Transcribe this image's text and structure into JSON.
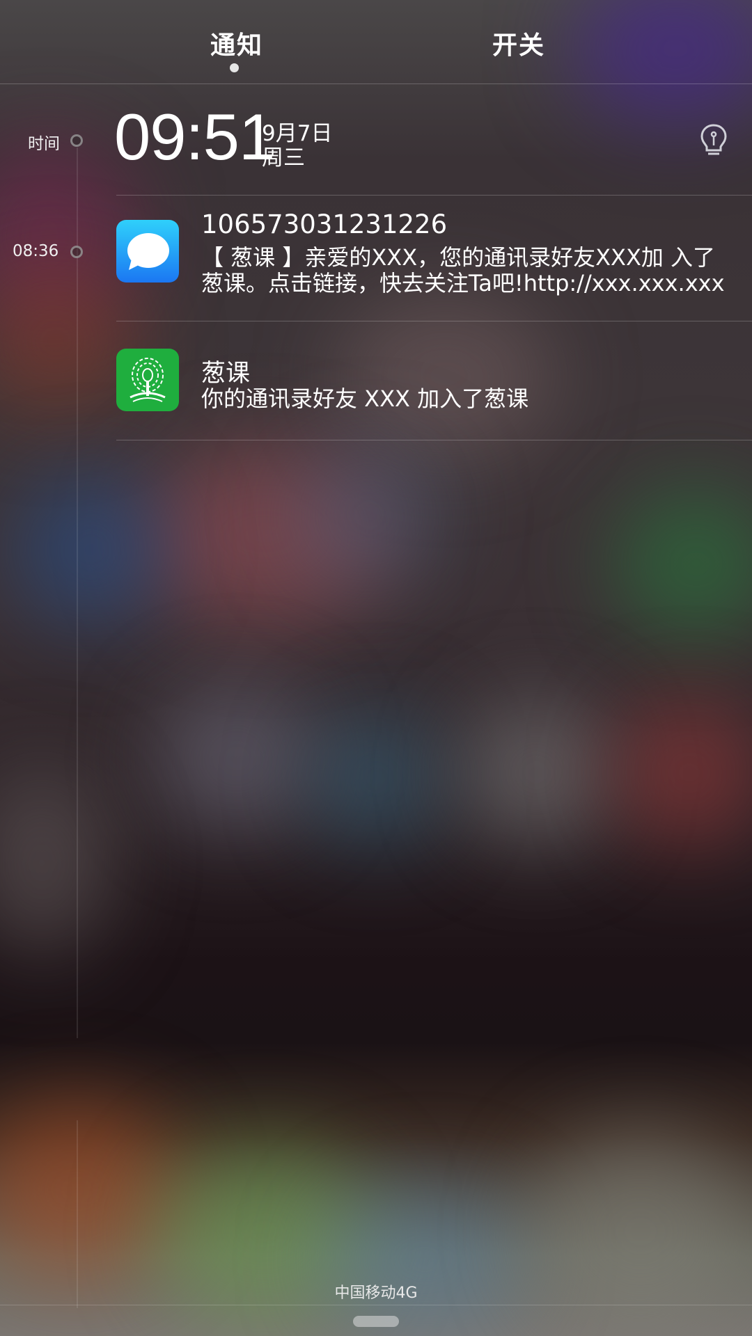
{
  "tabs": [
    {
      "label": "通知",
      "active": true
    },
    {
      "label": "开关",
      "active": false
    }
  ],
  "timeline": {
    "header_label": "时间",
    "entries": [
      "08:36"
    ]
  },
  "clock": {
    "time": "09:51",
    "date": "9月7日",
    "weekday": "周三"
  },
  "notifications": [
    {
      "app_icon": "message-bubble-icon",
      "title": "106573031231226",
      "body_line1": "【 葱课 】亲爱的XXX，您的通讯录好友XXX加 入了",
      "body_line2": "葱课。点击链接，快去关注Ta吧!http://xxx.xxx.xxx"
    },
    {
      "app_icon": "tree-logo-icon",
      "title": "葱课",
      "body_line1": "你的通讯录好友 XXX 加入了葱课"
    }
  ],
  "status": {
    "carrier": "中国移动4G"
  },
  "colors": {
    "message_icon_top": "#2fd0fb",
    "message_icon_bottom": "#1b77f2",
    "app_icon_green": "#1fae3e"
  }
}
